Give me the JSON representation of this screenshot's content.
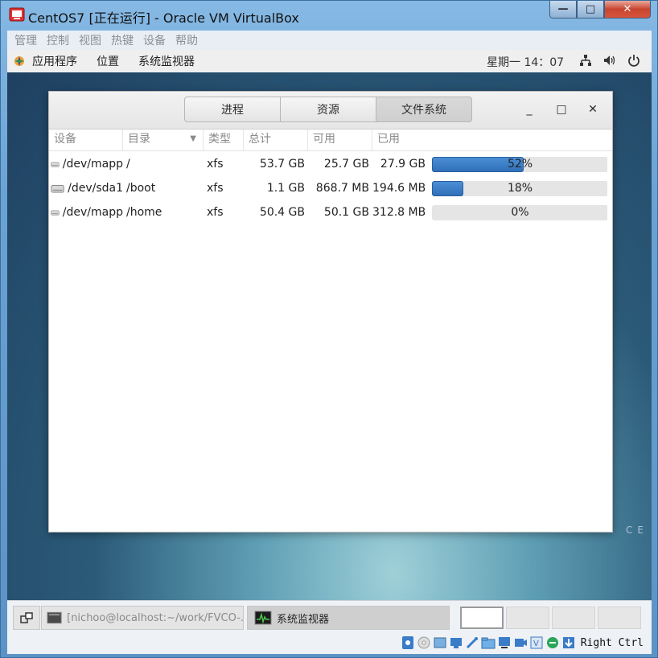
{
  "window": {
    "title": "CentOS7 [正在运行] - Oracle VM VirtualBox",
    "minimize": "—",
    "maximize": "□",
    "close": "✕"
  },
  "vbox_menu": [
    "管理",
    "控制",
    "视图",
    "热键",
    "设备",
    "帮助"
  ],
  "guest_panel": {
    "applications": "应用程序",
    "places": "位置",
    "sysmon": "系统监视器",
    "clock": "星期一 14：07"
  },
  "sysmon": {
    "tabs": [
      {
        "label": "进程",
        "active": false
      },
      {
        "label": "资源",
        "active": false
      },
      {
        "label": "文件系统",
        "active": true
      }
    ],
    "controls": {
      "minimize": "_",
      "maximize": "□",
      "close": "✕"
    },
    "columns": [
      "设备",
      "目录",
      "类型",
      "总计",
      "可用",
      "已用"
    ],
    "rows": [
      {
        "device": "/dev/mapp",
        "dir": "/",
        "type": "xfs",
        "total": "53.7 GB",
        "avail": "25.7 GB",
        "used": "27.9 GB",
        "pct_label": "52%",
        "pct": 52
      },
      {
        "device": "/dev/sda1",
        "dir": "/boot",
        "type": "xfs",
        "total": "1.1 GB",
        "avail": "868.7 MB",
        "used": "194.6 MB",
        "pct_label": "18%",
        "pct": 18
      },
      {
        "device": "/dev/mapp",
        "dir": "/home",
        "type": "xfs",
        "total": "50.4 GB",
        "avail": "50.1 GB",
        "used": "312.8 MB",
        "pct_label": "0%",
        "pct": 0
      }
    ]
  },
  "desktop": {
    "watermark": "CE"
  },
  "taskbar": {
    "terminal_label": "[nichoo@localhost:~/work/FVCO-…",
    "sysmon_label": "系统监视器"
  },
  "status": {
    "host_key": "Right Ctrl"
  },
  "colors": {
    "accent": "#3a7cc8",
    "desktop": "#2b5a78"
  }
}
